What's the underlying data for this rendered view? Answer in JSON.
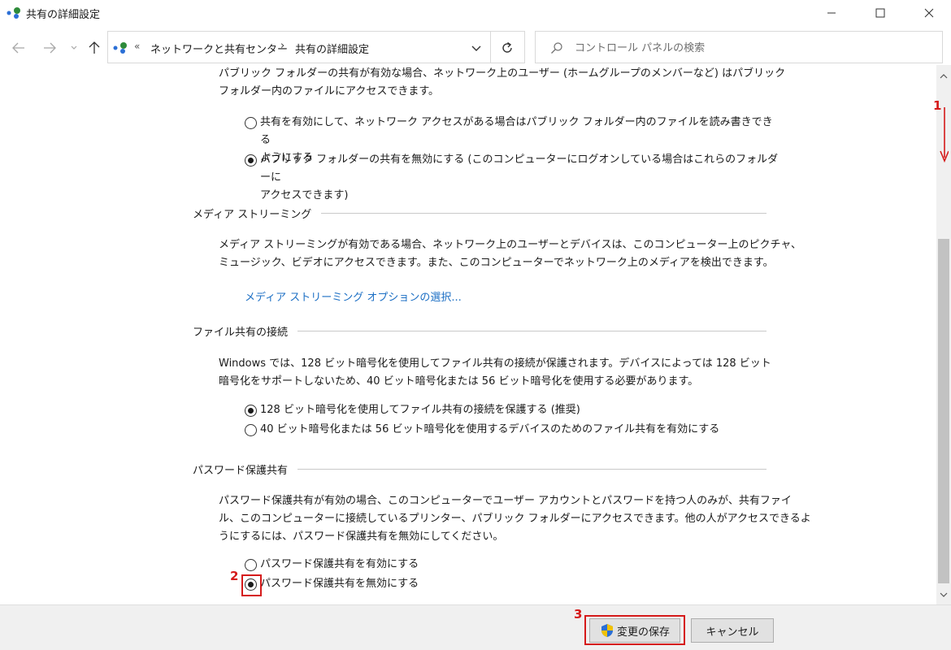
{
  "window": {
    "title": "共有の詳細設定"
  },
  "address_bar": {
    "overflow": "«",
    "crumbs": [
      "ネットワークと共有センター",
      "共有の詳細設定"
    ],
    "separator": "›"
  },
  "search": {
    "placeholder": "コントロール パネルの検索"
  },
  "public_folder": {
    "description_line1": "パブリック フォルダーの共有が有効な場合、ネットワーク上のユーザー (ホームグループのメンバーなど) はパブリック",
    "description_line2": "フォルダー内のファイルにアクセスできます。",
    "option_enable_line1": "共有を有効にして、ネットワーク アクセスがある場合はパブリック フォルダー内のファイルを読み書きできる",
    "option_enable_line2": "ようにする",
    "option_disable_line1": "パブリック フォルダーの共有を無効にする (このコンピューターにログオンしている場合はこれらのフォルダーに",
    "option_disable_line2": "アクセスできます)",
    "selected": "disable"
  },
  "media_streaming": {
    "heading": "メディア ストリーミング",
    "description_line1": "メディア ストリーミングが有効である場合、ネットワーク上のユーザーとデバイスは、このコンピューター上のピクチャ、",
    "description_line2": "ミュージック、ビデオにアクセスできます。また、このコンピューターでネットワーク上のメディアを検出できます。",
    "link": "メディア ストリーミング オプションの選択..."
  },
  "file_sharing": {
    "heading": "ファイル共有の接続",
    "description_line1": "Windows では、128 ビット暗号化を使用してファイル共有の接続が保護されます。デバイスによっては 128 ビット",
    "description_line2": "暗号化をサポートしないため、40 ビット暗号化または 56 ビット暗号化を使用する必要があります。",
    "option_128": "128 ビット暗号化を使用してファイル共有の接続を保護する (推奨)",
    "option_40_56": "40 ビット暗号化または 56 ビット暗号化を使用するデバイスのためのファイル共有を有効にする",
    "selected": "128"
  },
  "password_sharing": {
    "heading": "パスワード保護共有",
    "description_line1": "パスワード保護共有が有効の場合、このコンピューターでユーザー アカウントとパスワードを持つ人のみが、共有ファイ",
    "description_line2": "ル、このコンピューターに接続しているプリンター、パブリック フォルダーにアクセスできます。他の人がアクセスできるよ",
    "description_line3": "うにするには、パスワード保護共有を無効にしてください。",
    "option_enable": "パスワード保護共有を有効にする",
    "option_disable": "パスワード保護共有を無効にする",
    "selected": "disable"
  },
  "footer": {
    "save_label": "変更の保存",
    "cancel_label": "キャンセル"
  },
  "annotations": {
    "step1": "1",
    "step2": "2",
    "step3": "3",
    "color": "#d51a1a"
  },
  "colors": {
    "link": "#1c6fc4",
    "shield_blue": "#2b6fd6",
    "shield_yellow": "#f2c200"
  }
}
